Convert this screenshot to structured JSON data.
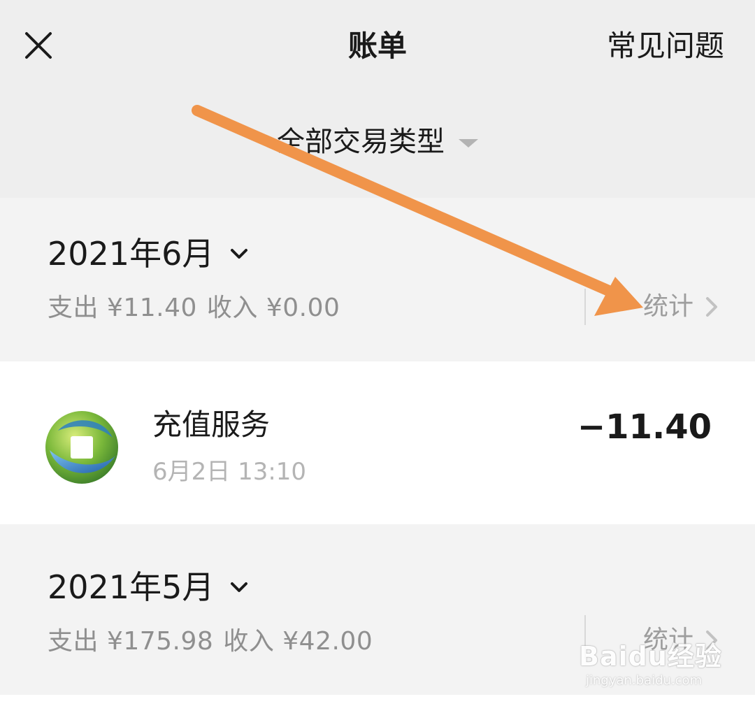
{
  "header": {
    "title": "账单",
    "faq_label": "常见问题"
  },
  "filter": {
    "label": "全部交易类型"
  },
  "months": [
    {
      "title": "2021年6月",
      "expense_label": "支出 ¥11.40",
      "income_label": "收入 ¥0.00",
      "stats_label": "统计"
    },
    {
      "title": "2021年5月",
      "expense_label": "支出 ¥175.98",
      "income_label": "收入 ¥42.00",
      "stats_label": "统计"
    }
  ],
  "transactions": [
    {
      "title": "充值服务",
      "time": "6月2日 13:10",
      "amount": "−11.40",
      "icon": "recharge-service-logo"
    }
  ],
  "watermark": {
    "main": "Baidu经验",
    "sub": "jingyan.baidu.com"
  },
  "colors": {
    "annotation_arrow": "#f0944a",
    "background": "#f1f1f1",
    "secondary_text": "#8f8f8f"
  }
}
